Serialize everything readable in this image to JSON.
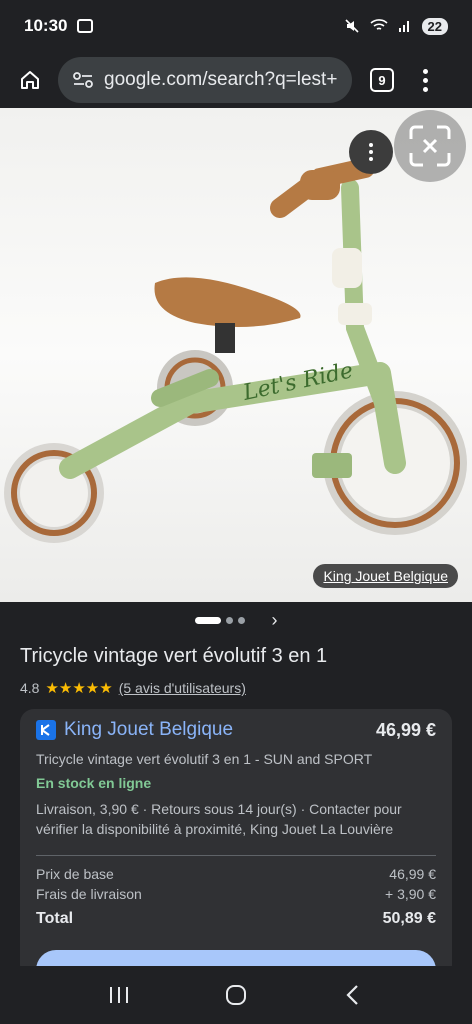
{
  "status_bar": {
    "time": "10:30",
    "battery": "22"
  },
  "browser": {
    "url": "google.com/search?q=lest+",
    "tab_count": "9"
  },
  "hero": {
    "source_chip": "King Jouet Belgique",
    "bike_text": "Let's Ride"
  },
  "product": {
    "title": "Tricycle vintage vert évolutif 3 en 1",
    "rating": "4.8",
    "stars": "★★★★★",
    "reviews": "(5 avis d'utilisateurs)"
  },
  "offer": {
    "seller": "King Jouet Belgique",
    "price": "46,99 €",
    "description": "Tricycle vintage vert évolutif 3 en 1 - SUN and SPORT",
    "stock": "En stock en ligne",
    "delivery": "Livraison, 3,90 € · Retours sous 14 jour(s) · Contacter pour vérifier la disponibilité à proximité, King Jouet La Louvière",
    "base_price_label": "Prix de base",
    "base_price": "46,99 €",
    "shipping_label": "Frais de livraison",
    "shipping": "+ 3,90 €",
    "total_label": "Total",
    "total": "50,89 €"
  },
  "colors": {
    "accent": "#8ab4f8",
    "stock_green": "#81c995",
    "star": "#fbbc04",
    "background": "#202124"
  }
}
